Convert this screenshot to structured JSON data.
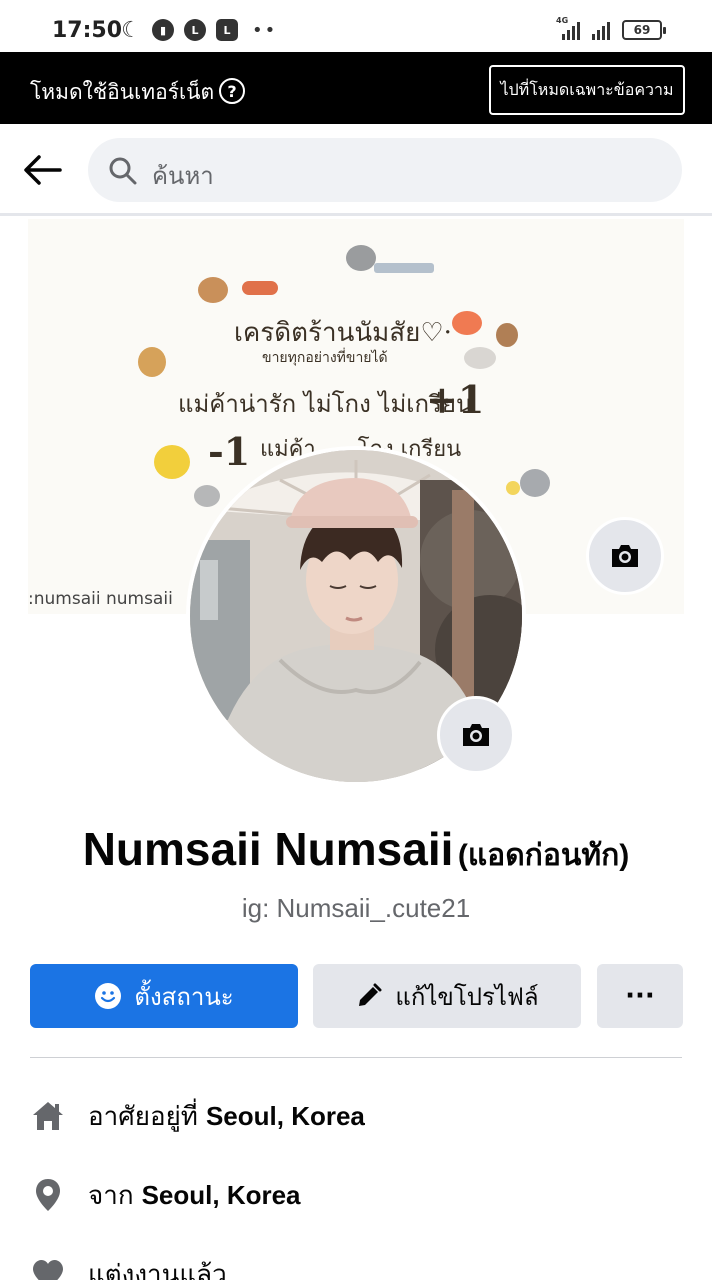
{
  "status_bar": {
    "time": "17:50",
    "network_label": "4G",
    "battery": "69",
    "icons": [
      "moon-icon",
      "stats-icon",
      "line-icon",
      "l-icon",
      "more-dots"
    ]
  },
  "data_banner": {
    "text": "โหมดใช้อินเทอร์เน็ต",
    "help_icon": "?",
    "button_label": "ไปที่โหมดเฉพาะข้อความ"
  },
  "search": {
    "placeholder": "ค้นหา"
  },
  "cover": {
    "lines": [
      "เครดิตร้านนัมสัย♡·",
      "ขายทุกอย่างที่ขายได้",
      "แม่ค้าน่ารัก ไม่โกง ไม่เกรียน",
      "-1",
      "แม่ค้า..... โกง เกรียน",
      "+1"
    ],
    "watermark": ":numsaii numsaii"
  },
  "profile": {
    "name": "Numsaii Numsaii",
    "alternate_name": "(แอดก่อนทัก)",
    "bio": "ig: Numsaii_.cute21"
  },
  "actions": {
    "status_label": "ตั้งสถานะ",
    "edit_label": "แก้ไขโปรไฟล์",
    "more_label": "···"
  },
  "intro": [
    {
      "icon": "home-icon",
      "prefix": "อาศัยอยู่ที่",
      "value": "Seoul, Korea"
    },
    {
      "icon": "location-pin-icon",
      "prefix": "จาก",
      "value": "Seoul, Korea"
    },
    {
      "icon": "heart-icon",
      "prefix": "แต่งงานแล้ว",
      "value": ""
    }
  ],
  "colors": {
    "accent": "#1b74e4",
    "secondary_button": "#e4e6eb",
    "banner_bg": "#000000"
  }
}
